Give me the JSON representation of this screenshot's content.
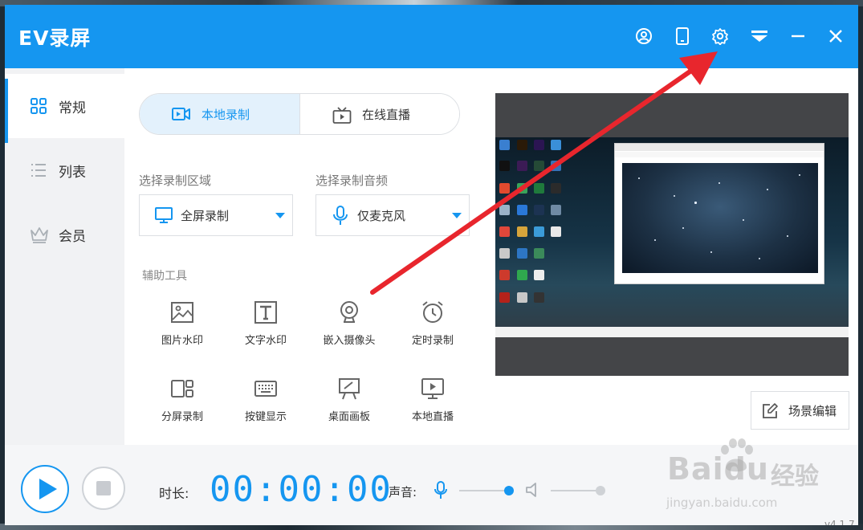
{
  "app": {
    "title": "EV录屏",
    "version": "v4.1.7"
  },
  "titlebar": {
    "buttons": [
      {
        "name": "user-icon"
      },
      {
        "name": "phone-icon"
      },
      {
        "name": "gear-icon"
      },
      {
        "name": "skin-icon"
      },
      {
        "name": "minimize-icon"
      },
      {
        "name": "close-icon"
      }
    ]
  },
  "sidebar": {
    "items": [
      {
        "label": "常规",
        "icon": "grid-icon",
        "active": true
      },
      {
        "label": "列表",
        "icon": "list-icon",
        "active": false
      },
      {
        "label": "会员",
        "icon": "crown-icon",
        "active": false
      }
    ]
  },
  "tabs": {
    "local_label": "本地录制",
    "online_label": "在线直播"
  },
  "area": {
    "label": "选择录制区域",
    "value": "全屏录制"
  },
  "audio": {
    "label": "选择录制音频",
    "value": "仅麦克风"
  },
  "tools": {
    "label": "辅助工具",
    "items": [
      {
        "label": "图片水印",
        "icon": "image-icon"
      },
      {
        "label": "文字水印",
        "icon": "text-icon"
      },
      {
        "label": "嵌入摄像头",
        "icon": "webcam-icon"
      },
      {
        "label": "定时录制",
        "icon": "alarm-icon"
      },
      {
        "label": "分屏录制",
        "icon": "split-screen-icon"
      },
      {
        "label": "按键显示",
        "icon": "keyboard-icon"
      },
      {
        "label": "桌面画板",
        "icon": "easel-icon"
      },
      {
        "label": "本地直播",
        "icon": "play-screen-icon"
      }
    ]
  },
  "preview": {
    "scene_edit_label": "场景编辑"
  },
  "bottom": {
    "duration_label": "时长:",
    "time": "00:00:00",
    "volume_label": "声音:",
    "mic_level": 1.0,
    "speaker_level": 1.0
  },
  "watermark": {
    "brand": "Baidu",
    "cn": "经验",
    "url": "jingyan.baidu.com"
  },
  "colors": {
    "accent": "#1596f0",
    "annotation_arrow": "#e8262d"
  }
}
